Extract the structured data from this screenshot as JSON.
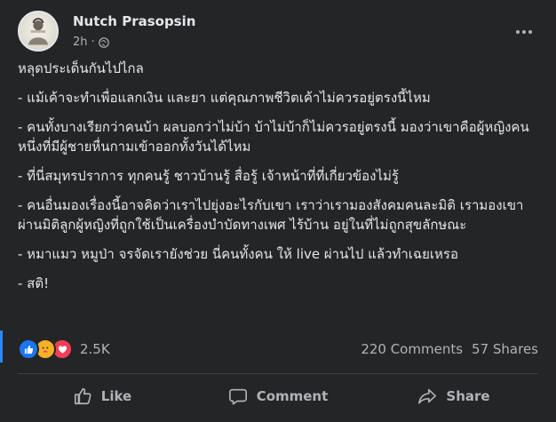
{
  "post": {
    "author": "Nutch Prasopsin",
    "time": "2h",
    "dot": "·",
    "privacy_icon": "globe-icon",
    "more_icon": "more-horizontal-icon",
    "paragraphs": [
      "หลุดประเด็นกันไปไกล",
      "- แม้เค้าจะทำเพื่อแลกเงิน และยา แต่คุณภาพชีวิตเค้าไม่ควรอยู่ตรงนี้ไหม",
      "- คนทั้งบางเรียกว่าคนบ้า ผลบอกว่าไม่บ้า บ้าไม่บ้าก็ไม่ควรอยู่ตรงนี้ มองว่าเขาคือผู้หญิงคนหนึ่งที่มีผู้ชายหื่นกามเข้าออกทั้งวันได้ไหม",
      "- ที่นี่สมุทรปราการ ทุกคนรู้ ชาวบ้านรู้ สื่อรู้ เจ้าหน้าที่ที่เกี่ยวข้องไม่รู้",
      "- คนอื่นมองเรื่องนี้อาจคิดว่าเราไปยุ่งอะไรกับเขา เราว่าเรามองสังคมคนละมิติ เรามองเขาผ่านมิติลูกผู้หญิงที่ถูกใช้เป็นเครื่องบำบัดทางเพศ ไร้บ้าน อยู่ในที่ไม่ถูกสุขลักษณะ",
      "- หมาแมว หมูป่า จรจัดเรายังช่วย นี่คนทั้งคน ให้ live ผ่านไป แล้วทำเฉยเหรอ",
      "- สติ!"
    ]
  },
  "stats": {
    "reaction_icons": [
      "like-reaction-icon",
      "care-reaction-icon",
      "love-reaction-icon"
    ],
    "reaction_count": "2.5K",
    "comments": "220 Comments",
    "shares": "57 Shares"
  },
  "actions": {
    "like": "Like",
    "comment": "Comment",
    "share": "Share"
  },
  "colors": {
    "background": "#242526",
    "text": "#e4e6eb",
    "secondary_text": "#b0b3b8",
    "like_blue": "#1877f2",
    "love_red": "#f33e58",
    "care_yellow": "#f7b125"
  }
}
